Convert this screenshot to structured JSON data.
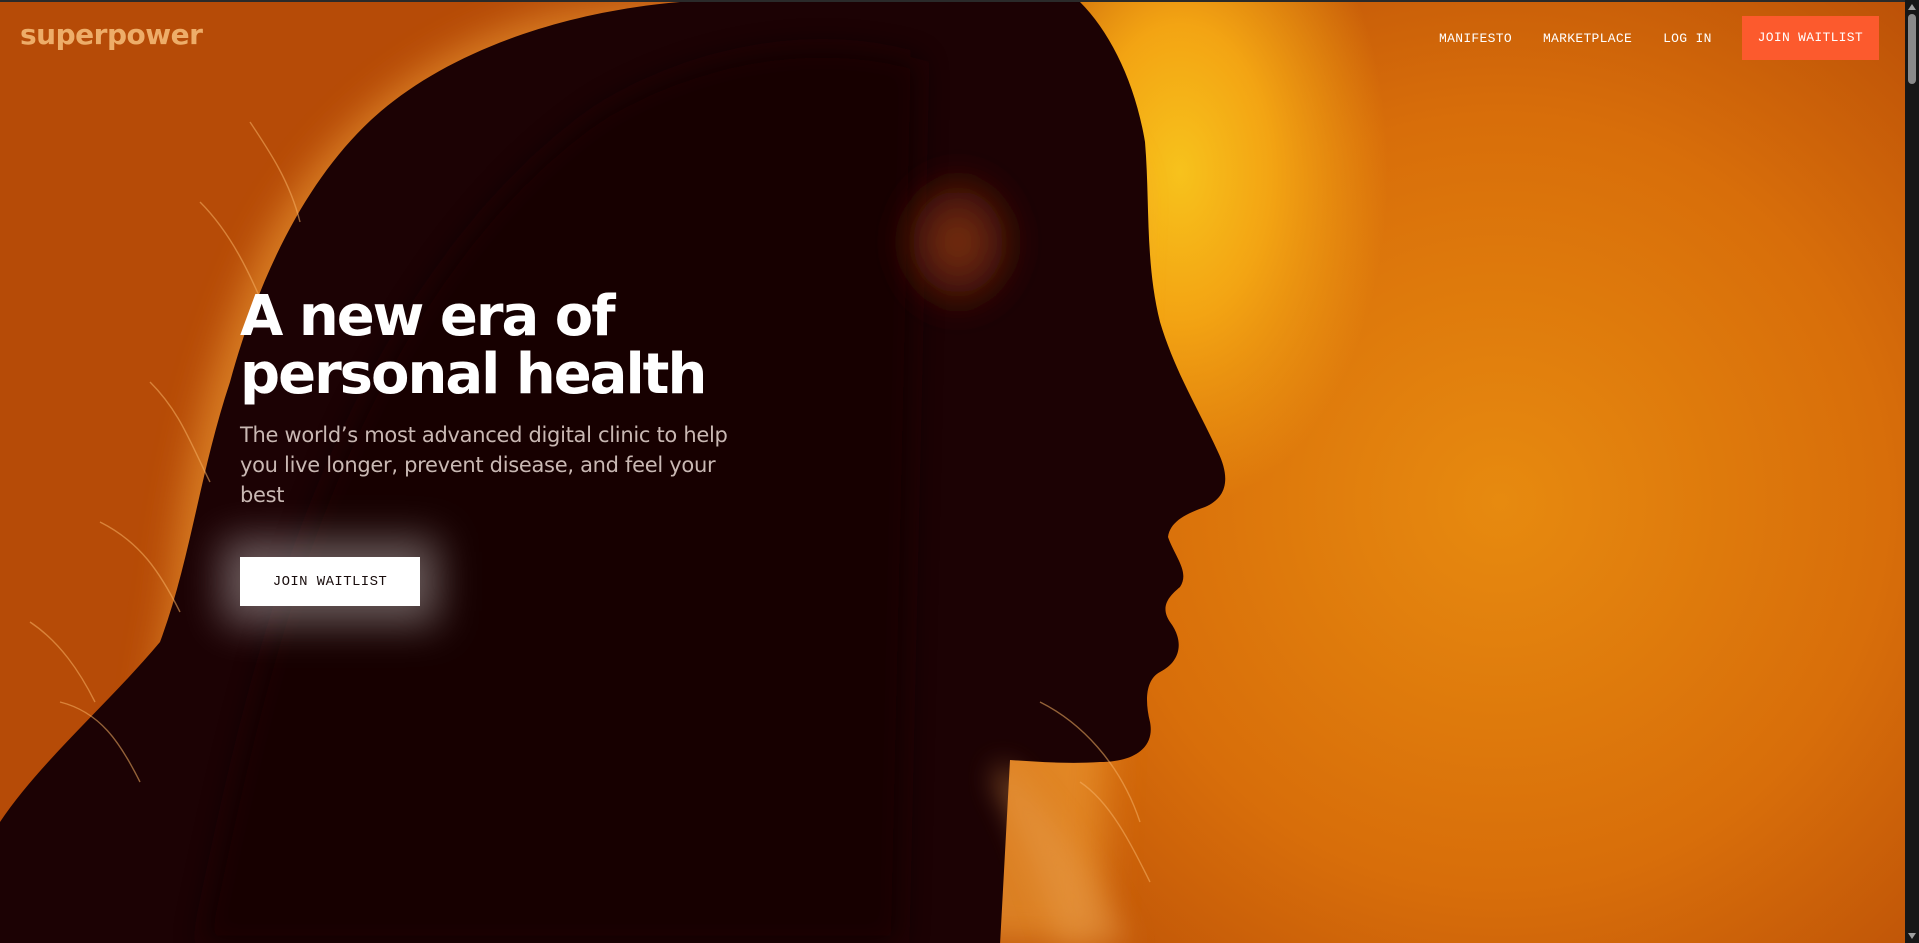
{
  "brand": {
    "logo_text": "superpower",
    "accent_color": "#fc5a2d",
    "background_color": "#e48210"
  },
  "nav": {
    "links": [
      {
        "label": "MANIFESTO"
      },
      {
        "label": "MARKETPLACE"
      },
      {
        "label": "LOG IN"
      }
    ],
    "cta_label": "JOIN WAITLIST"
  },
  "hero": {
    "title_line_1": "A new era of",
    "title_line_2": "personal health",
    "subtitle": "The world’s most advanced digital clinic to help you live longer, prevent disease, and feel your best",
    "cta_label": "JOIN WAITLIST",
    "background_image": "woman-profile-silhouette"
  }
}
